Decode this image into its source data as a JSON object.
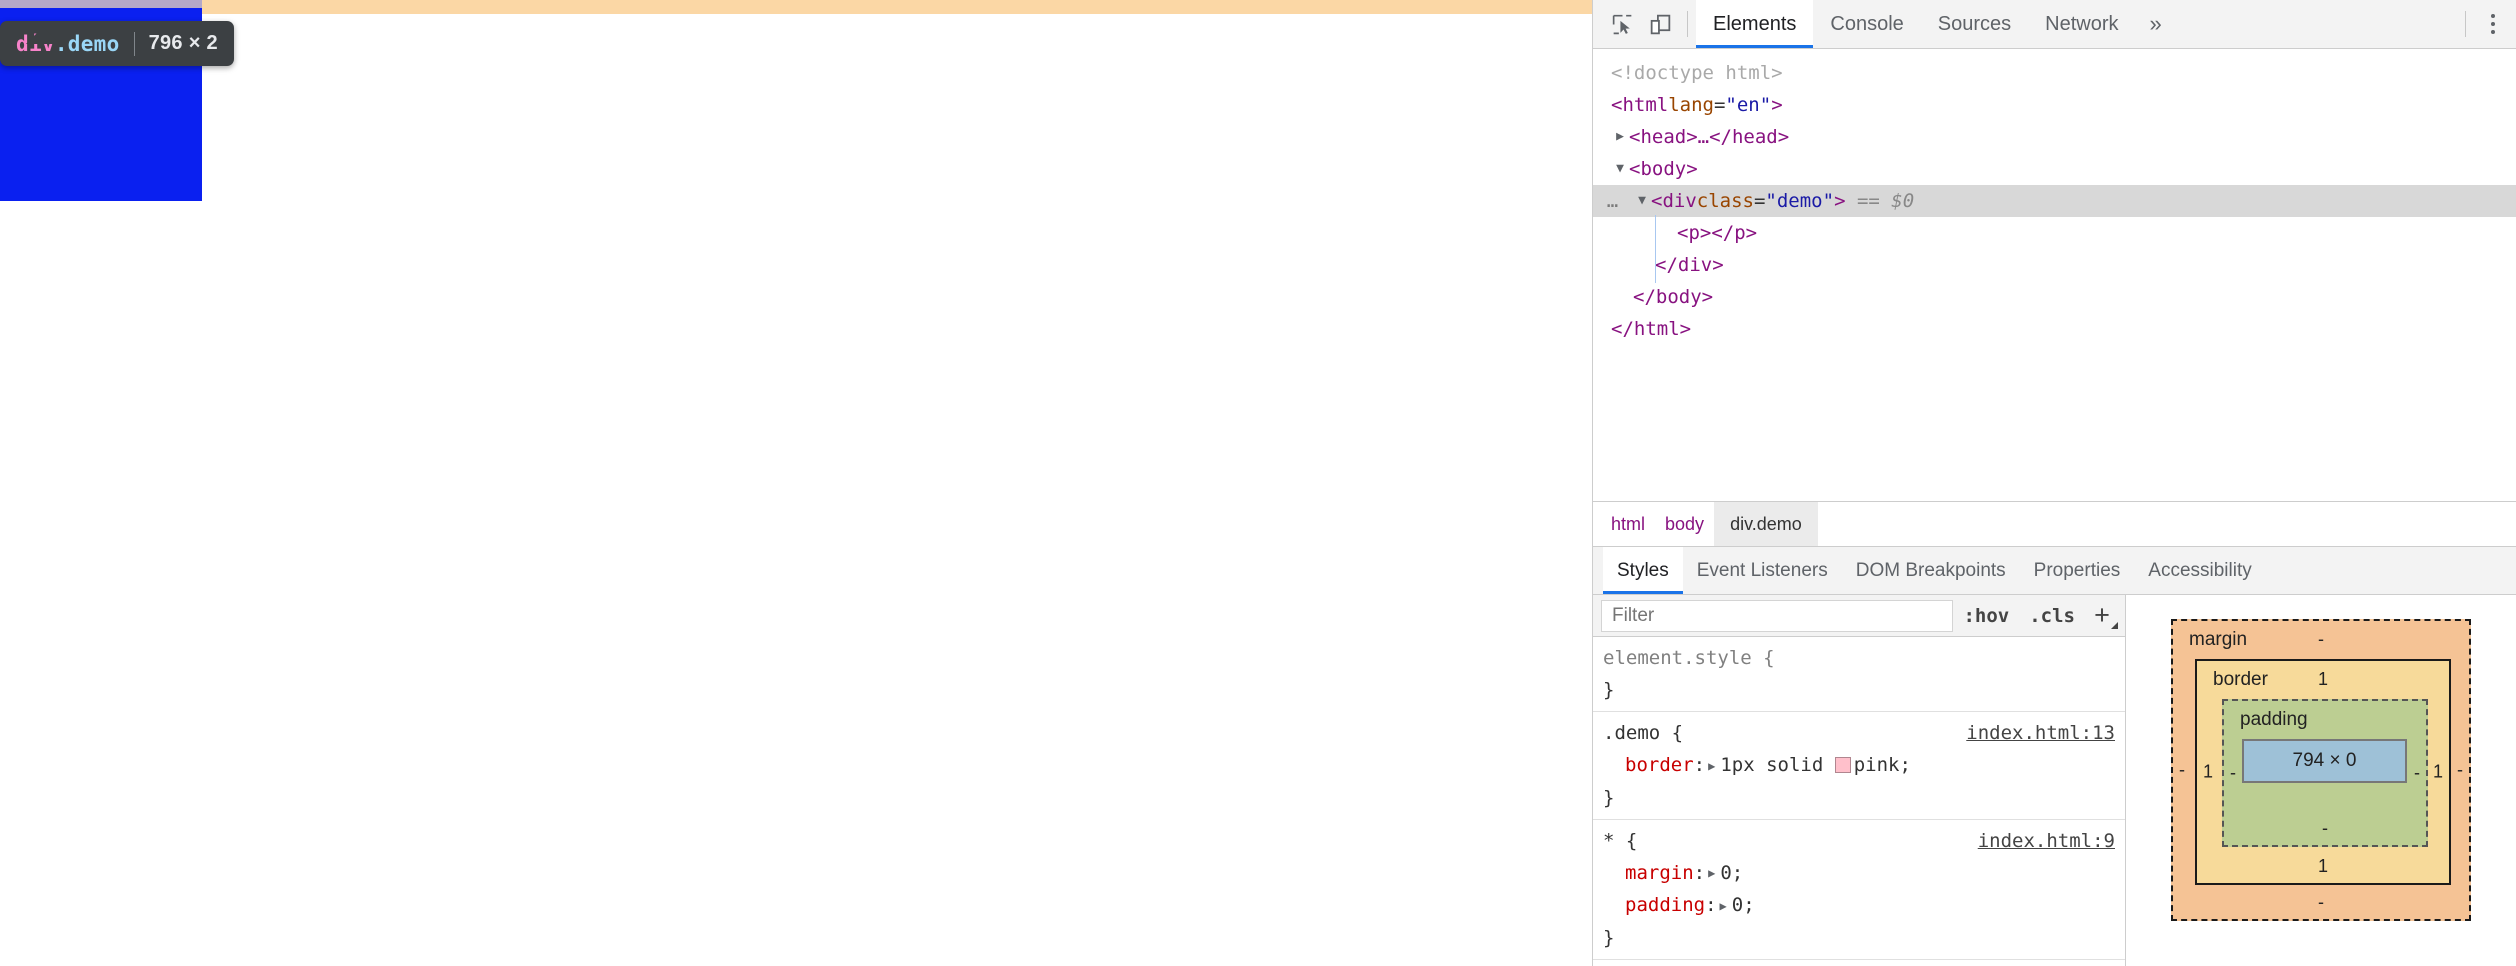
{
  "page": {
    "inspect_tooltip": {
      "tag": "div",
      "class": ".demo",
      "dimensions": "796 × 2",
      "background": "#3c4043",
      "tag_color": "#f783ca",
      "class_color": "#9ad7f7"
    },
    "highlight": {
      "content_color": "#0a20f0",
      "margin_color": "#fbd7a5",
      "border_color": "#b4a8c8"
    }
  },
  "devtools": {
    "toolbar": {
      "inspect_icon": "inspect-element-icon",
      "device_icon": "device-toolbar-icon",
      "more_tabs_label": "»",
      "kebab_icon": "more-options-icon",
      "tabs": [
        {
          "label": "Elements",
          "active": true
        },
        {
          "label": "Console",
          "active": false
        },
        {
          "label": "Sources",
          "active": false
        },
        {
          "label": "Network",
          "active": false
        }
      ]
    },
    "dom": {
      "rows": [
        {
          "text": "<!doctype html>"
        },
        {
          "tag": "html",
          "attr": "lang",
          "value": "en"
        },
        {
          "tag": "head"
        },
        {
          "tag": "body"
        },
        {
          "tag": "div",
          "attr": "class",
          "value": "demo",
          "marker": "== $0",
          "ellipsis": "…",
          "selected": true
        },
        {
          "tag": "p"
        },
        {
          "text": "</div>"
        },
        {
          "text": "</body>"
        },
        {
          "text": "</html>"
        }
      ],
      "tokens": {
        "doctype": "<!doctype html>",
        "html_open_a": "<html ",
        "html_attr": "lang",
        "html_eq": "=",
        "html_value": "\"en\"",
        "html_close": ">",
        "head_collapsed": "<head>…</head>",
        "body_open": "<body>",
        "div_open_a": "<div ",
        "div_attr": "class",
        "div_eq": "=",
        "div_value": "\"demo\"",
        "div_close": ">",
        "div_marker": "== $0",
        "div_ellipsis": "…",
        "p_line": "<p></p>",
        "div_end": "</div>",
        "body_end": "</body>",
        "html_end": "</html>",
        "twisty_collapsed": "▶",
        "twisty_expanded": "▼"
      }
    },
    "breadcrumb": [
      {
        "label": "html",
        "active": false
      },
      {
        "label": "body",
        "active": false
      },
      {
        "label": "div.demo",
        "active": true
      }
    ],
    "sidebar_tabs": [
      {
        "label": "Styles",
        "active": true
      },
      {
        "label": "Event Listeners",
        "active": false
      },
      {
        "label": "DOM Breakpoints",
        "active": false
      },
      {
        "label": "Properties",
        "active": false
      },
      {
        "label": "Accessibility",
        "active": false
      }
    ],
    "styles": {
      "filter_placeholder": "Filter",
      "hov_label": ":hov",
      "cls_label": ".cls",
      "new_rule_label": "+",
      "rules": [
        {
          "selector": "element.style {",
          "origin": "",
          "declarations": [],
          "close": "}"
        },
        {
          "selector": ".demo {",
          "origin": "index.html:13",
          "declarations": [
            {
              "prop": "border",
              "expander": "▶",
              "value": "1px solid ",
              "swatch": "#ffc0cb",
              "value2": "pink;"
            }
          ],
          "close": "}"
        },
        {
          "selector": "* {",
          "origin": "index.html:9",
          "declarations": [
            {
              "prop": "margin",
              "expander": "▶",
              "value": "0;"
            },
            {
              "prop": "padding",
              "expander": "▶",
              "value": "0;"
            }
          ],
          "close": "}"
        }
      ]
    },
    "box_model": {
      "margin_label": "margin",
      "margin_top": "-",
      "margin_right": "-",
      "margin_bottom": "-",
      "margin_left": "-",
      "border_label": "border",
      "border_top": "1",
      "border_right": "1",
      "border_bottom": "1",
      "border_left": "1",
      "padding_label": "padding",
      "padding_top": "-",
      "padding_right": "-",
      "padding_bottom": "-",
      "padding_left": "-",
      "content_size": "794 × 0",
      "colors": {
        "margin": "#f5c395",
        "border": "#f7da9a",
        "padding": "#bcce92",
        "content": "#9ec1d7"
      }
    }
  }
}
